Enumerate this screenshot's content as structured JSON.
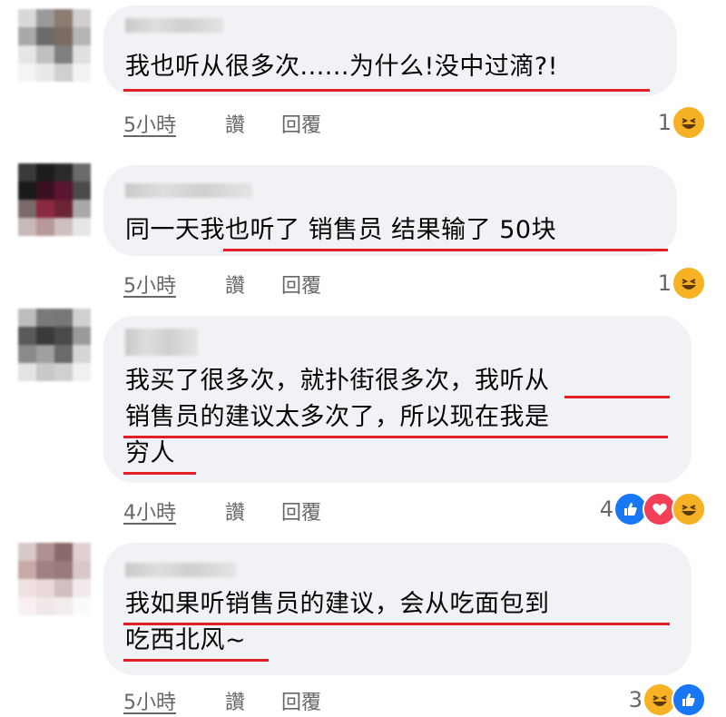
{
  "comments": [
    {
      "text": "我也听从很多次......为什么!没中过滴?!",
      "time": "5小時",
      "like_label": "讚",
      "reply_label": "回覆",
      "reaction_count": "1",
      "reactions": [
        "haha"
      ]
    },
    {
      "text": "同一天我也听了 销售员 结果输了 50块",
      "time": "5小時",
      "like_label": "讚",
      "reply_label": "回覆",
      "reaction_count": "1",
      "reactions": [
        "haha"
      ]
    },
    {
      "text": "我买了很多次，就扑街很多次，我听从\n销售员的建议太多次了，所以现在我是\n穷人",
      "time": "4小時",
      "like_label": "讚",
      "reply_label": "回覆",
      "reaction_count": "4",
      "reactions": [
        "like",
        "love",
        "haha"
      ]
    },
    {
      "text": "我如果听销售员的建议，会从吃面包到\n吃西北风~",
      "time": "5小時",
      "like_label": "讚",
      "reply_label": "回覆",
      "reaction_count": "3",
      "reactions": [
        "haha",
        "like"
      ]
    }
  ],
  "colors": {
    "bubble": "#f0f2f5",
    "underline": "#e41e26",
    "like": "#1877f2",
    "love": "#f33e58",
    "haha": "#f7b125"
  }
}
